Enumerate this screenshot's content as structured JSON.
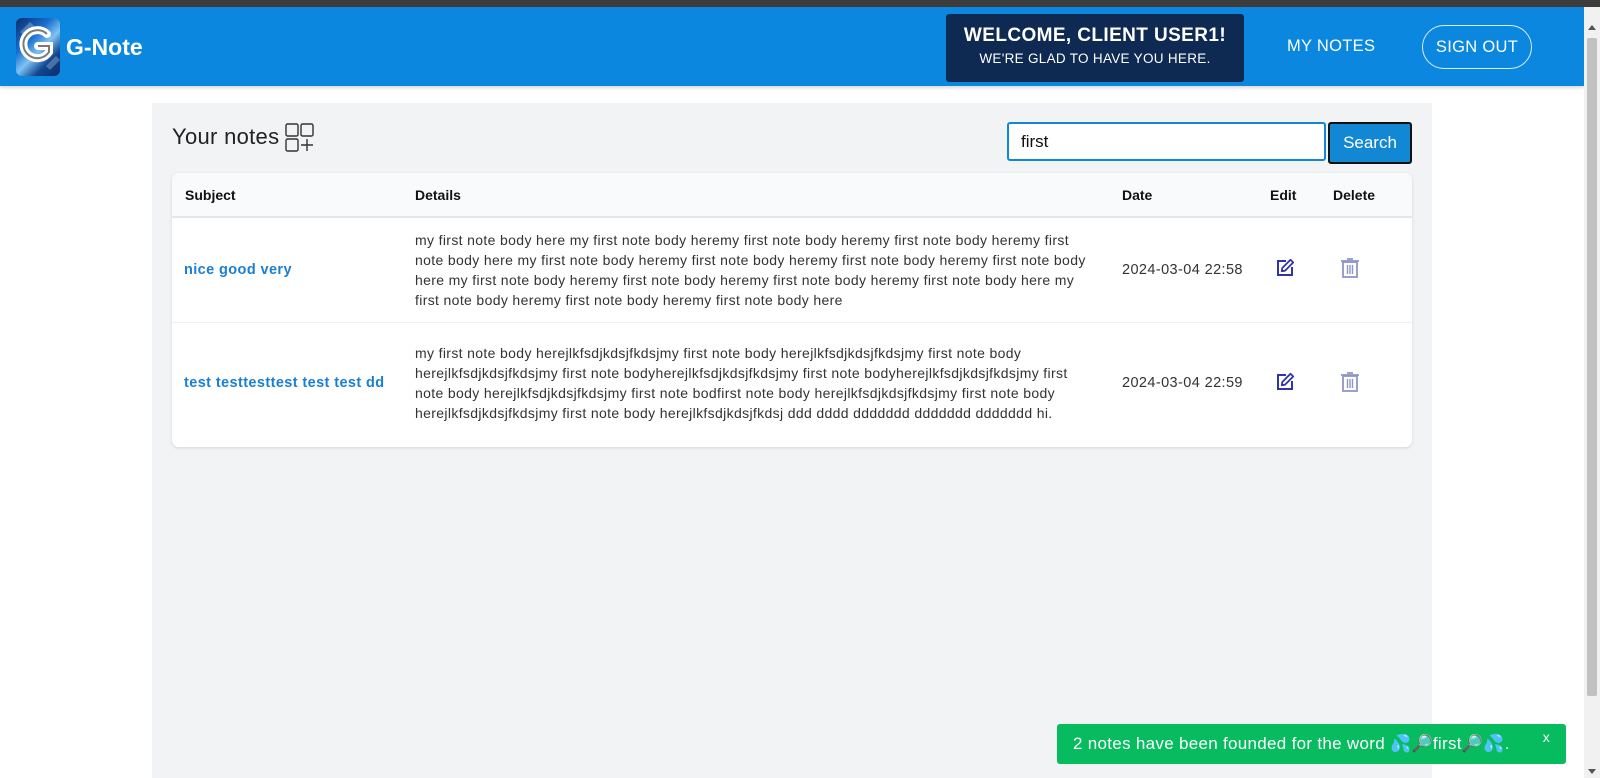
{
  "app": {
    "brand_name": "G-Note"
  },
  "header": {
    "welcome_title": "WELCOME, CLIENT USER1!",
    "welcome_subtitle": "WE'RE GLAD TO HAVE YOU HERE.",
    "nav_my_notes": "MY NOTES",
    "nav_sign_out": "SIGN OUT"
  },
  "notes_panel": {
    "title": "Your notes",
    "search_value": "first",
    "search_button": "Search",
    "columns": {
      "subject": "Subject",
      "details": "Details",
      "date": "Date",
      "edit": "Edit",
      "delete": "Delete"
    },
    "rows": [
      {
        "subject": "nice good very",
        "details": "my first note body here my first note body heremy first note body heremy first note body heremy first note body here my first note body heremy first note body heremy first note body heremy first note body here my first note body heremy first note body heremy first note body heremy first note body here my first note body heremy first note body heremy first note body here",
        "date": "2024-03-04 22:58"
      },
      {
        "subject": "test testtesttest test test dd",
        "details": "my first note body herejlkfsdjkdsjfkdsjmy first note body herejlkfsdjkdsjfkdsjmy first note body herejlkfsdjkdsjfkdsjmy first note bodyherejlkfsdjkdsjfkdsjmy first note bodyherejlkfsdjkdsjfkdsjmy first note body herejlkfsdjkdsjfkdsjmy first note bodfirst note body herejlkfsdjkdsjfkdsjmy first note body herejlkfsdjkdsjfkdsjmy first note body herejlkfsdjkdsjfkdsj ddd dddd ddddddd ddddddd ddddddd hi.",
        "date": "2024-03-04 22:59"
      }
    ]
  },
  "toast": {
    "message": "2 notes have been founded for the word 💦🔎first🔎💦.",
    "close": "x"
  },
  "icons": {
    "add_note": "grid-plus-icon",
    "edit": "edit-icon",
    "delete": "trash-icon"
  },
  "colors": {
    "navbar": "#0b87e0",
    "welcome_bg": "#0e2a52",
    "link": "#1a7fd4",
    "toast": "#07bc5f",
    "edit_icon": "#2f35a8",
    "delete_icon": "#8f95c8"
  }
}
